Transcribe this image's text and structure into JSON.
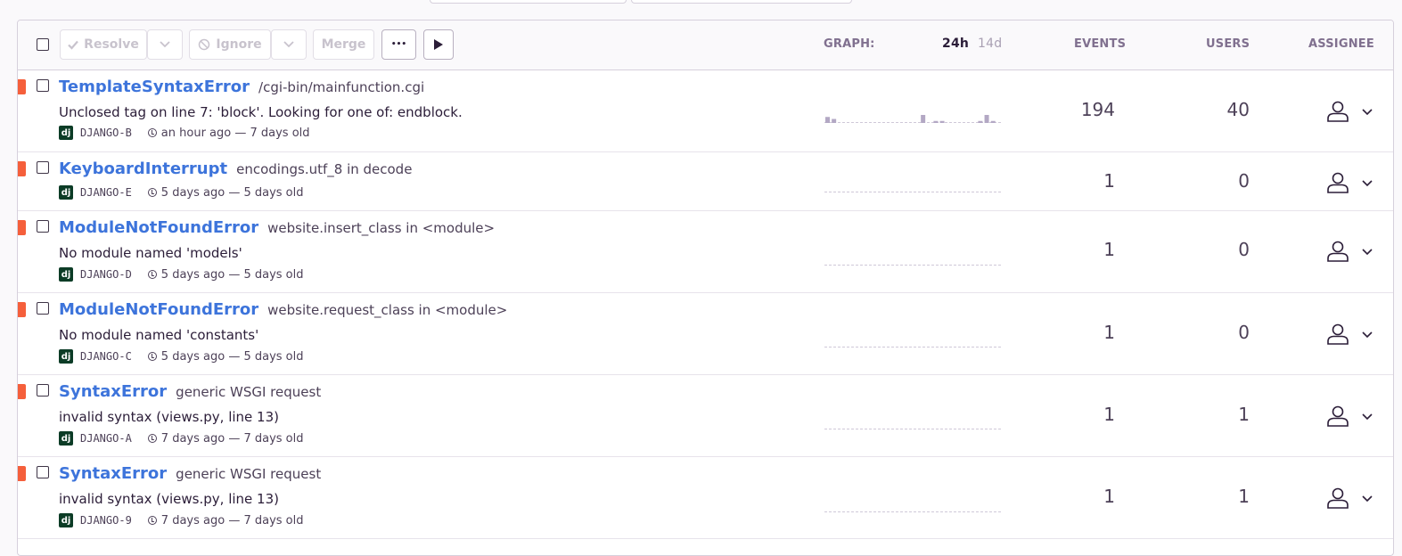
{
  "toolbar": {
    "resolve_label": "Resolve",
    "ignore_label": "Ignore",
    "merge_label": "Merge",
    "more_label": "•••"
  },
  "columns": {
    "graph_label": "GRAPH:",
    "period_24h": "24h",
    "period_14d": "14d",
    "events_label": "EVENTS",
    "users_label": "USERS",
    "assignee_label": "ASSIGNEE"
  },
  "colors": {
    "accent_link": "#3d74db",
    "level_error": "#f55f3b",
    "platform_django": "#0c3c26",
    "sparkline": "#b3a8c4"
  },
  "issues": [
    {
      "type": "TemplateSyntaxError",
      "location": "/cgi-bin/mainfunction.cgi",
      "message": "Unclosed tag on line 7: 'block'. Looking for one of: endblock.",
      "platform": "dj",
      "short_id": "DJANGO-B",
      "time": "an hour ago — 7 days old",
      "events": "194",
      "users": "40",
      "sparkline": [
        3,
        2,
        0,
        0,
        0,
        0,
        0,
        0,
        0,
        0,
        0,
        0,
        0,
        0,
        0,
        4,
        0,
        1,
        1,
        0,
        0,
        0,
        0,
        0,
        1,
        4,
        1,
        0
      ]
    },
    {
      "type": "KeyboardInterrupt",
      "location": "encodings.utf_8 in decode",
      "message": "",
      "platform": "dj",
      "short_id": "DJANGO-E",
      "time": "5 days ago — 5 days old",
      "events": "1",
      "users": "0",
      "sparkline": []
    },
    {
      "type": "ModuleNotFoundError",
      "location": "website.insert_class in <module>",
      "message": "No module named 'models'",
      "platform": "dj",
      "short_id": "DJANGO-D",
      "time": "5 days ago — 5 days old",
      "events": "1",
      "users": "0",
      "sparkline": []
    },
    {
      "type": "ModuleNotFoundError",
      "location": "website.request_class in <module>",
      "message": "No module named 'constants'",
      "platform": "dj",
      "short_id": "DJANGO-C",
      "time": "5 days ago — 5 days old",
      "events": "1",
      "users": "0",
      "sparkline": []
    },
    {
      "type": "SyntaxError",
      "location": "generic WSGI request",
      "message": "invalid syntax (views.py, line 13)",
      "platform": "dj",
      "short_id": "DJANGO-A",
      "time": "7 days ago — 7 days old",
      "events": "1",
      "users": "1",
      "sparkline": []
    },
    {
      "type": "SyntaxError",
      "location": "generic WSGI request",
      "message": "invalid syntax (views.py, line 13)",
      "platform": "dj",
      "short_id": "DJANGO-9",
      "time": "7 days ago — 7 days old",
      "events": "1",
      "users": "1",
      "sparkline": []
    }
  ]
}
